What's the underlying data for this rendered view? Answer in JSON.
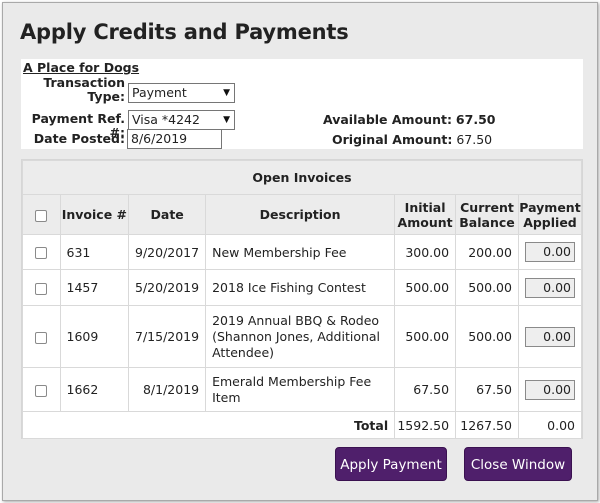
{
  "window_title": "Apply Credits and Payments",
  "organization": "A Place for Dogs",
  "form": {
    "transaction_type_label": "Transaction Type:",
    "transaction_type_value": "Payment",
    "payment_ref_label": "Payment Ref. #:",
    "payment_ref_value": "Visa *4242",
    "date_posted_label": "Date Posted:",
    "date_posted_value": "8/6/2019",
    "available_amount_label": "Available Amount:",
    "available_amount_value": "67.50",
    "original_amount_label": "Original Amount:",
    "original_amount_value": "67.50"
  },
  "invoices": {
    "caption": "Open Invoices",
    "headers": {
      "invoice": "Invoice #",
      "date": "Date",
      "description": "Description",
      "initial_1": "Initial",
      "initial_2": "Amount",
      "current_1": "Current",
      "current_2": "Balance",
      "applied_1": "Payment",
      "applied_2": "Applied"
    },
    "rows": [
      {
        "invoice": "631",
        "date": "9/20/2017",
        "description": "New Membership Fee",
        "initial": "300.00",
        "current": "200.00",
        "applied": "0.00"
      },
      {
        "invoice": "1457",
        "date": "5/20/2019",
        "description": "2018 Ice Fishing Contest",
        "initial": "500.00",
        "current": "500.00",
        "applied": "0.00"
      },
      {
        "invoice": "1609",
        "date": "7/15/2019",
        "description": "2019 Annual BBQ & Rodeo (Shannon Jones, Additional Attendee)",
        "initial": "500.00",
        "current": "500.00",
        "applied": "0.00"
      },
      {
        "invoice": "1662",
        "date": "8/1/2019",
        "description": "Emerald Membership Fee Item",
        "initial": "67.50",
        "current": "67.50",
        "applied": "0.00"
      }
    ],
    "total_label": "Total",
    "total_initial": "1592.50",
    "total_current": "1267.50",
    "total_applied": "0.00"
  },
  "buttons": {
    "apply": "Apply Payment",
    "close": "Close Window"
  },
  "colors": {
    "button_bg": "#4f1f6b",
    "panel_bg": "#eaeaea"
  },
  "icons": {
    "dropdown": "▼"
  }
}
